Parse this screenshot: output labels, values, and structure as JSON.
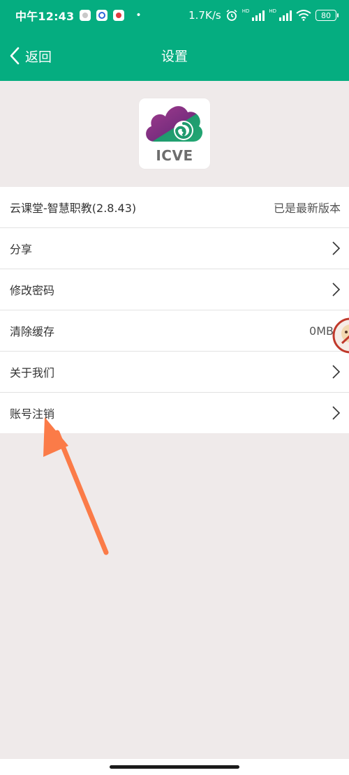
{
  "status_bar": {
    "time": "中午12:43",
    "network_speed": "1.7K/s",
    "hd_label_1": "HD",
    "hd_label_2": "HD",
    "battery": "80"
  },
  "nav": {
    "back_label": "返回",
    "title": "设置"
  },
  "logo": {
    "text": "ICVE"
  },
  "settings": {
    "items": [
      {
        "label": "云课堂-智慧职教(2.8.43)",
        "value": "已是最新版本"
      },
      {
        "label": "分享",
        "value": ""
      },
      {
        "label": "修改密码",
        "value": ""
      },
      {
        "label": "清除缓存",
        "value": "0MB"
      },
      {
        "label": "关于我们",
        "value": ""
      },
      {
        "label": "账号注销",
        "value": ""
      }
    ]
  },
  "colors": {
    "primary": "#05ad80",
    "background": "#efeaea",
    "annotation_arrow": "#fb7b48"
  }
}
